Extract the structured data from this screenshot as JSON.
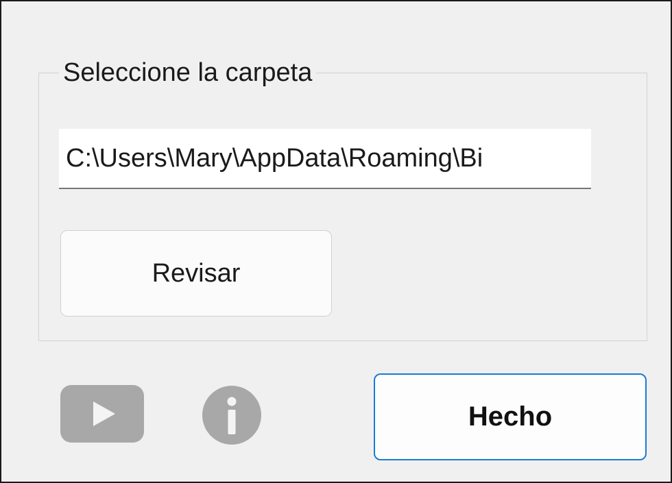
{
  "folder_group": {
    "legend": "Seleccione la carpeta",
    "path_value": "C:\\Users\\Mary\\AppData\\Roaming\\Bi",
    "browse_label": "Revisar"
  },
  "footer": {
    "youtube_icon": "youtube-play-icon",
    "info_icon": "info-icon",
    "done_label": "Hecho"
  },
  "colors": {
    "window_bg": "#f0f0f0",
    "accent_border": "#1a7ad6",
    "icon_gray": "#a8a8a8"
  }
}
